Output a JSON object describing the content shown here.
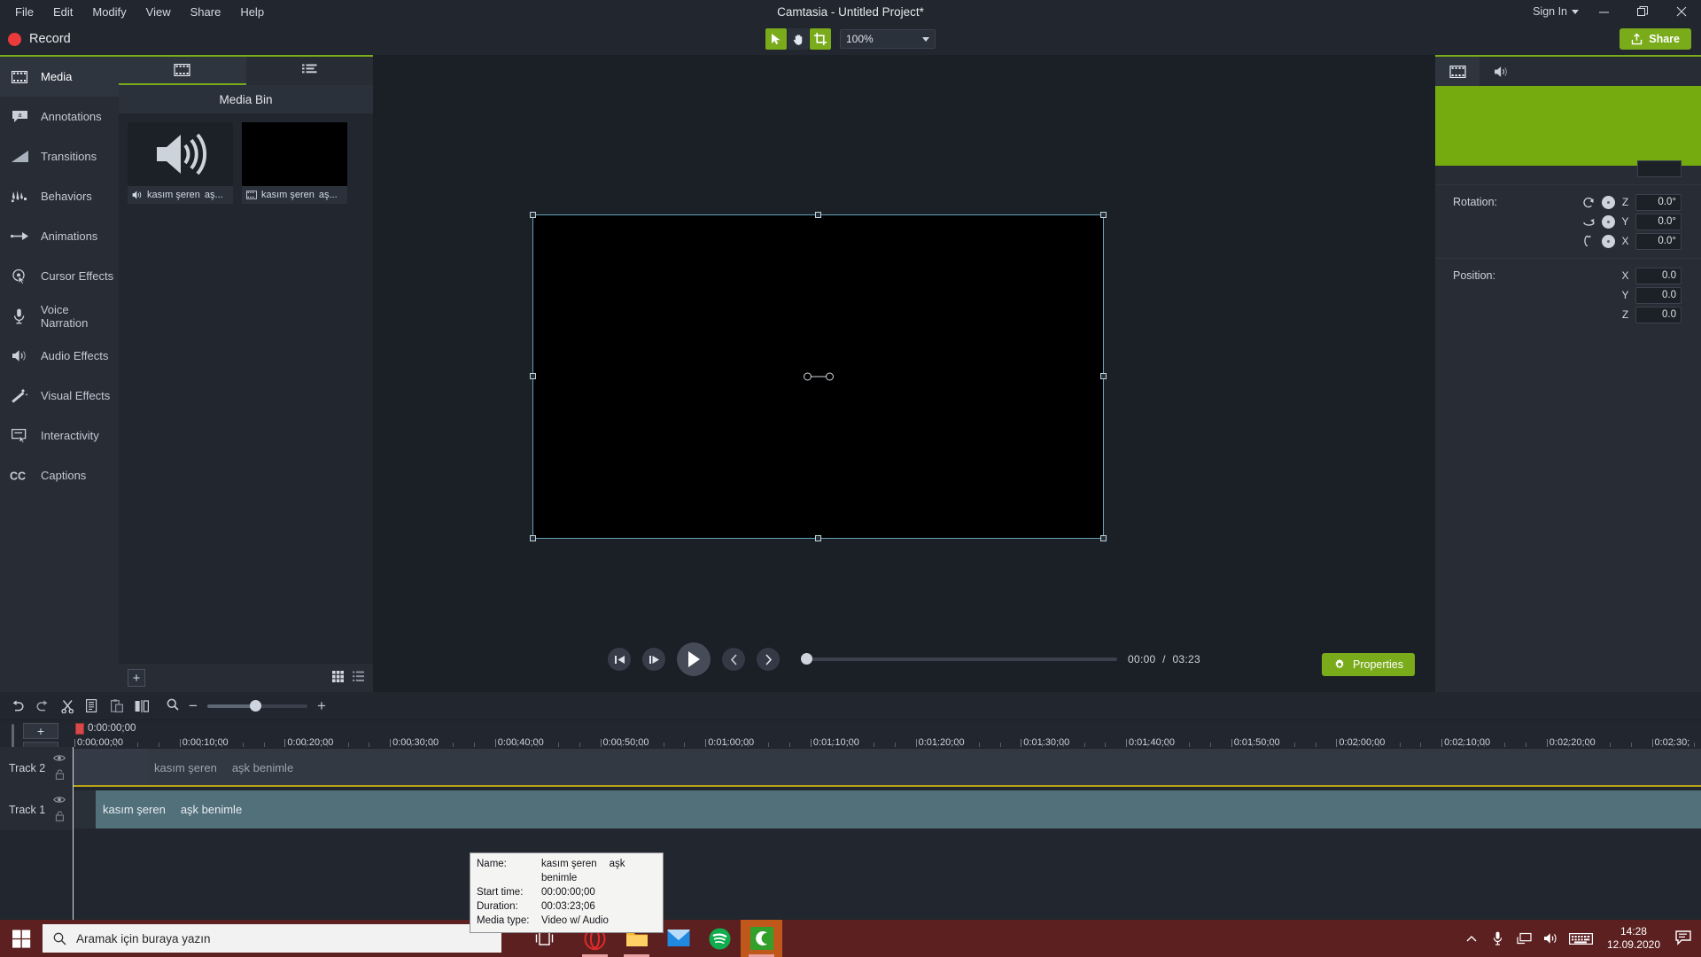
{
  "window": {
    "title": "Camtasia - Untitled Project*",
    "sign_in": "Sign In",
    "minimize": "—",
    "maximize": "❐",
    "close": "✕"
  },
  "menu": [
    {
      "label": "File"
    },
    {
      "label": "Edit"
    },
    {
      "label": "Modify"
    },
    {
      "label": "View"
    },
    {
      "label": "Share"
    },
    {
      "label": "Help"
    }
  ],
  "toolbar": {
    "record_label": "Record",
    "zoom_value": "100%",
    "share_label": "Share",
    "tools": [
      {
        "name": "pointer-tool",
        "active": true
      },
      {
        "name": "hand-tool",
        "active": false
      },
      {
        "name": "crop-tool",
        "active": true
      }
    ]
  },
  "sidebar": {
    "items": [
      {
        "label": "Media",
        "icon": "film-strip-icon",
        "active": true
      },
      {
        "label": "Annotations",
        "icon": "callout-icon",
        "active": false
      },
      {
        "label": "Transitions",
        "icon": "transition-icon",
        "active": false
      },
      {
        "label": "Behaviors",
        "icon": "behaviors-icon",
        "active": false
      },
      {
        "label": "Animations",
        "icon": "arrow-animation-icon",
        "active": false
      },
      {
        "label": "Cursor Effects",
        "icon": "cursor-effects-icon",
        "active": false
      },
      {
        "label": "Voice Narration",
        "icon": "microphone-icon",
        "active": false
      },
      {
        "label": "Audio Effects",
        "icon": "speaker-icon",
        "active": false
      },
      {
        "label": "Visual Effects",
        "icon": "magic-wand-icon",
        "active": false
      },
      {
        "label": "Interactivity",
        "icon": "interactivity-icon",
        "active": false
      },
      {
        "label": "Captions",
        "icon": "cc-icon",
        "active": false
      }
    ]
  },
  "media_bin": {
    "title": "Media Bin",
    "tabs": [
      {
        "name": "media-bin-tab",
        "icon": "film-strip-icon",
        "active": true
      },
      {
        "name": "library-tab",
        "icon": "list-icon",
        "active": false
      }
    ],
    "items": [
      {
        "name_main": "kasım şeren",
        "name_sub": "aş...",
        "icon": "speaker-icon",
        "thumb": "audio"
      },
      {
        "name_main": "kasım şeren",
        "name_sub": "aş...",
        "icon": "film-strip-icon",
        "thumb": "video"
      }
    ],
    "add_label": "+",
    "view_grid": "grid-view-icon",
    "view_list": "list-view-icon"
  },
  "player": {
    "prev_frame": "step-back-icon",
    "next_frame": "step-forward-icon",
    "play": "play-icon",
    "prev_marker": "previous-icon",
    "next_marker": "next-icon",
    "current_time": "00:00",
    "separator": "/",
    "total_time": "03:23",
    "properties_label": "Properties"
  },
  "properties": {
    "tabs": [
      {
        "name": "visual-properties-tab",
        "icon": "film-strip-icon",
        "active": true
      },
      {
        "name": "audio-properties-tab",
        "icon": "speaker-icon",
        "active": false
      }
    ],
    "rotation": {
      "label": "Rotation:",
      "axes": [
        {
          "axis": "Z",
          "value": "0.0°"
        },
        {
          "axis": "Y",
          "value": "0.0°"
        },
        {
          "axis": "X",
          "value": "0.0°"
        }
      ]
    },
    "position": {
      "label": "Position:",
      "axes": [
        {
          "axis": "X",
          "value": "0.0"
        },
        {
          "axis": "Y",
          "value": "0.0"
        },
        {
          "axis": "Z",
          "value": "0.0"
        }
      ]
    }
  },
  "timeline": {
    "tools": [
      {
        "name": "undo-button",
        "icon": "undo-icon"
      },
      {
        "name": "redo-button",
        "icon": "redo-icon"
      },
      {
        "name": "cut-button",
        "icon": "scissors-icon"
      },
      {
        "name": "copy-button",
        "icon": "copy-icon"
      },
      {
        "name": "paste-button",
        "icon": "paste-icon"
      },
      {
        "name": "split-button",
        "icon": "split-icon"
      }
    ],
    "zoom_out": "−",
    "zoom_in": "+",
    "playhead_time": "0:00:00;00",
    "ruler_labels": [
      "0:00:00;00",
      "0:00:10;00",
      "0:00:20;00",
      "0:00:30;00",
      "0:00:40;00",
      "0:00:50;00",
      "0:01:00;00",
      "0:01:10;00",
      "0:01:20;00",
      "0:01:30;00",
      "0:01:40;00",
      "0:01:50;00",
      "0:02:00;00",
      "0:02:10;00",
      "0:02:20;00",
      "0:02:30;"
    ],
    "tracks": [
      {
        "label": "Track 2",
        "clip_main": "kasım şeren",
        "clip_sub": "aşk benimle"
      },
      {
        "label": "Track 1",
        "clip_main": "kasım şeren",
        "clip_sub": "aşk benimle"
      }
    ]
  },
  "tooltip": {
    "rows": [
      {
        "key": "Name:",
        "value_main": "kasım şeren",
        "value_sub": "aşk benimle"
      },
      {
        "key": "Start time:",
        "value_main": "00:00:00;00",
        "value_sub": ""
      },
      {
        "key": "Duration:",
        "value_main": "00:03:23;06",
        "value_sub": ""
      },
      {
        "key": "Media type:",
        "value_main": "Video w/ Audio",
        "value_sub": ""
      }
    ]
  },
  "taskbar": {
    "search_placeholder": "Aramak için buraya yazın",
    "clock_time": "14:28",
    "clock_date": "12.09.2020",
    "apps": [
      {
        "name": "task-view-icon"
      },
      {
        "name": "opera-icon"
      },
      {
        "name": "file-explorer-icon"
      },
      {
        "name": "mail-icon"
      },
      {
        "name": "spotify-icon"
      },
      {
        "name": "camtasia-icon"
      }
    ]
  },
  "colors": {
    "accent_green": "#7aab1b",
    "panel_bg": "#272c35",
    "app_bg": "#22262e",
    "record_red": "#ea3a3a",
    "taskbar": "#5c2020"
  }
}
